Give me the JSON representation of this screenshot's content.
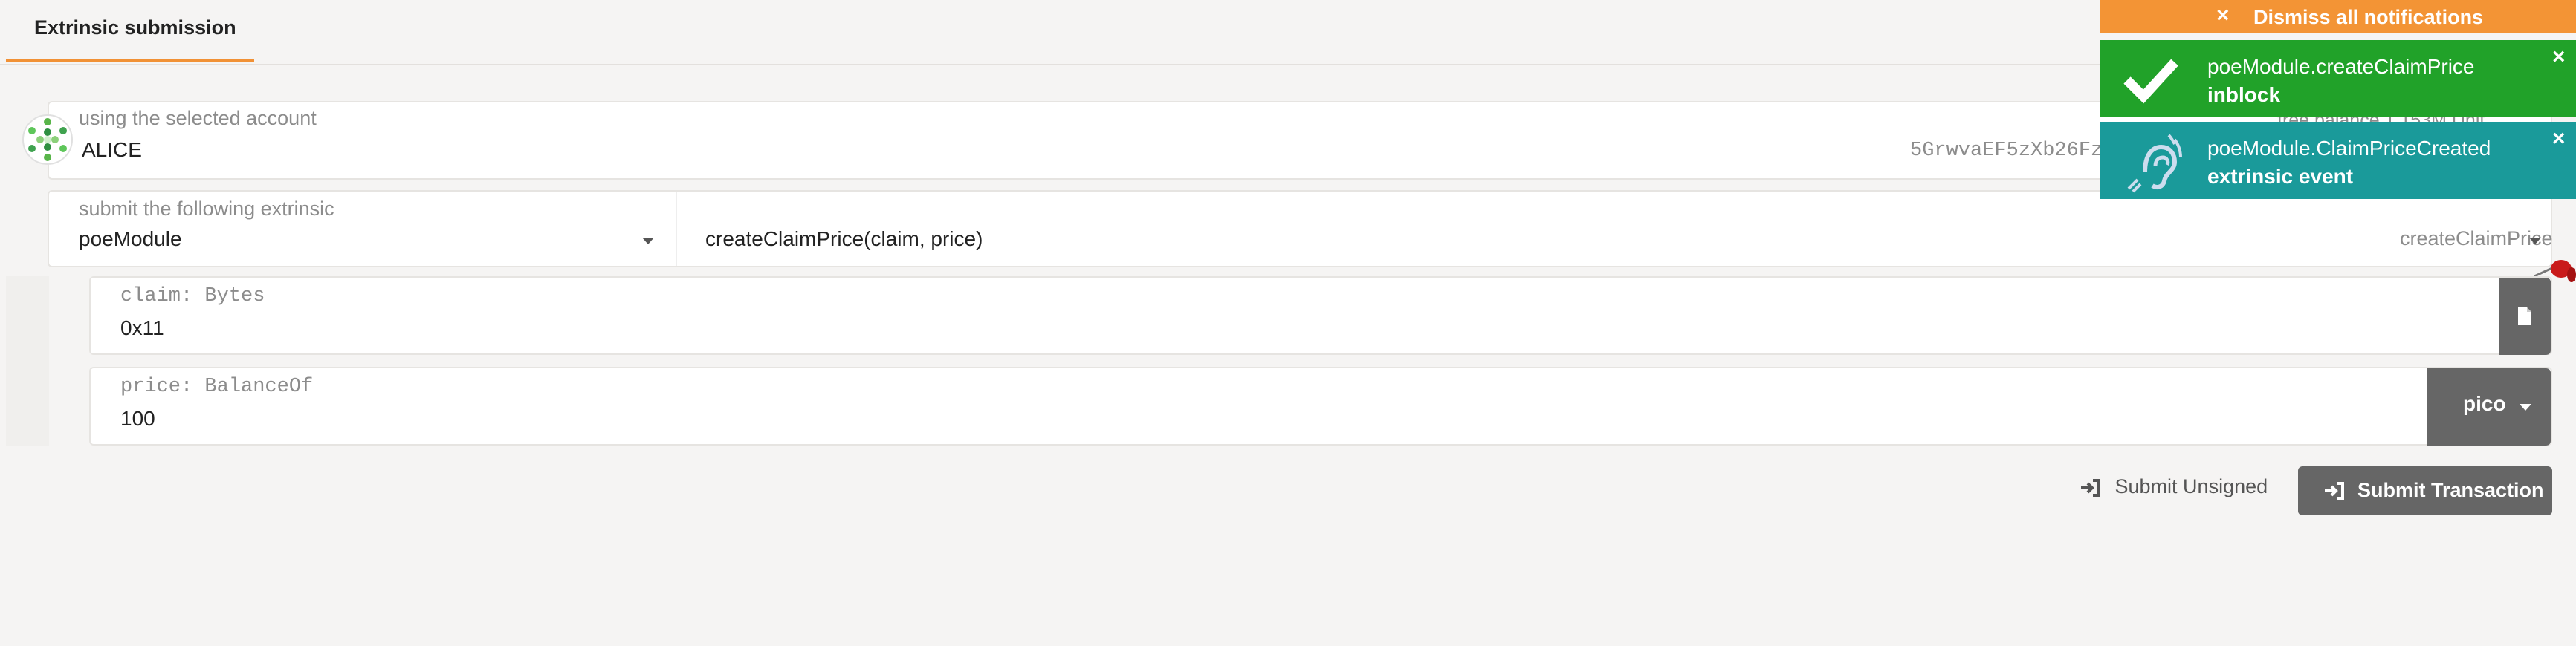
{
  "tabs": [
    {
      "label": "Extrinsic submission"
    }
  ],
  "account": {
    "label": "using the selected account",
    "name": "ALICE",
    "address": "5GrwvaEF5zXb26Fz",
    "free_balance": "free balance 1.153M Unit"
  },
  "extrinsic": {
    "label": "submit the following extrinsic",
    "module": "poeModule",
    "call_signature": "createClaimPrice(claim, price)",
    "call_selected": "createClaimPrice"
  },
  "params": [
    {
      "label": "claim: Bytes",
      "value": "0x11"
    },
    {
      "label": "price: BalanceOf",
      "value": "100",
      "unit": "pico"
    }
  ],
  "actions": {
    "submit_unsigned": "Submit Unsigned",
    "submit_transaction": "Submit Transaction"
  },
  "notifications": {
    "dismiss_all": "Dismiss all notifications",
    "items": [
      {
        "title": "poeModule.createClaimPrice",
        "status": "inblock",
        "color": "#21a229",
        "icon": "check-icon"
      },
      {
        "title": "poeModule.ClaimPriceCreated",
        "status": "extrinsic event",
        "color": "#1a9a9a",
        "icon": "assistive-listening-icon"
      }
    ]
  },
  "colors": {
    "accent": "#f19135",
    "button": "#666666",
    "background": "#f5f4f3"
  }
}
